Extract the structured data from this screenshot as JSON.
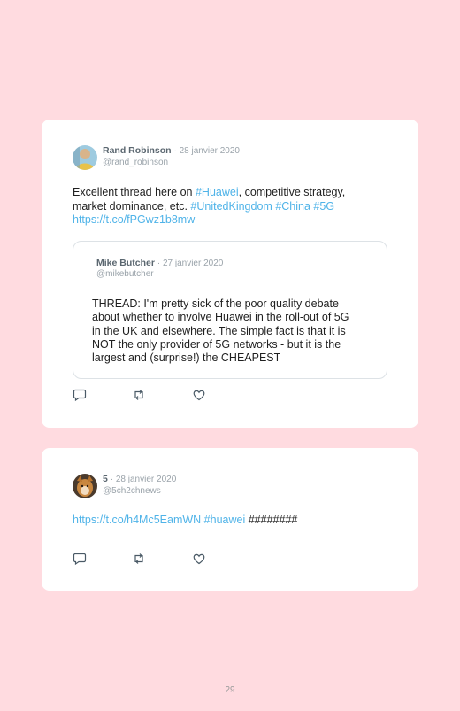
{
  "page_number": "29",
  "tweets": [
    {
      "author": "Rand Robinson",
      "date": "· 28 janvier 2020",
      "handle": "@rand_robinson",
      "text_parts": {
        "p1": "Excellent thread here on ",
        "h1": "#Huawei",
        "p2": ", competitive strategy,",
        "p3": "market dominance, etc. ",
        "h2": "#UnitedKingdom",
        "h3": "#China",
        "h4": "#5G",
        "url": "https://t.co/fPGwz1b8mw"
      },
      "quoted": {
        "author": "Mike Butcher",
        "date": "· 27 janvier 2020",
        "handle": "@mikebutcher",
        "lines": [
          "THREAD: I'm pretty sick of the poor quality debate",
          "about whether to involve Huawei in the roll-out of 5G",
          "in the UK and elsewhere. The simple fact is that it is",
          "NOT the only provider of 5G networks - but it is the",
          "largest and (surprise!) the CHEAPEST"
        ]
      }
    },
    {
      "author": "5",
      "date": "· 28 janvier 2020",
      "handle": "@5ch2chnews",
      "text_parts": {
        "url": "https://t.co/h4Mc5EamWN",
        "h1": "#huawei",
        "rest": "########"
      }
    }
  ],
  "icons": [
    "reply-icon",
    "retweet-icon",
    "like-icon"
  ],
  "colors": {
    "background": "#ffdbe0",
    "card": "#ffffff",
    "link": "#4fb3e8",
    "name": "#5b6770",
    "meta": "#9aa3aa"
  }
}
